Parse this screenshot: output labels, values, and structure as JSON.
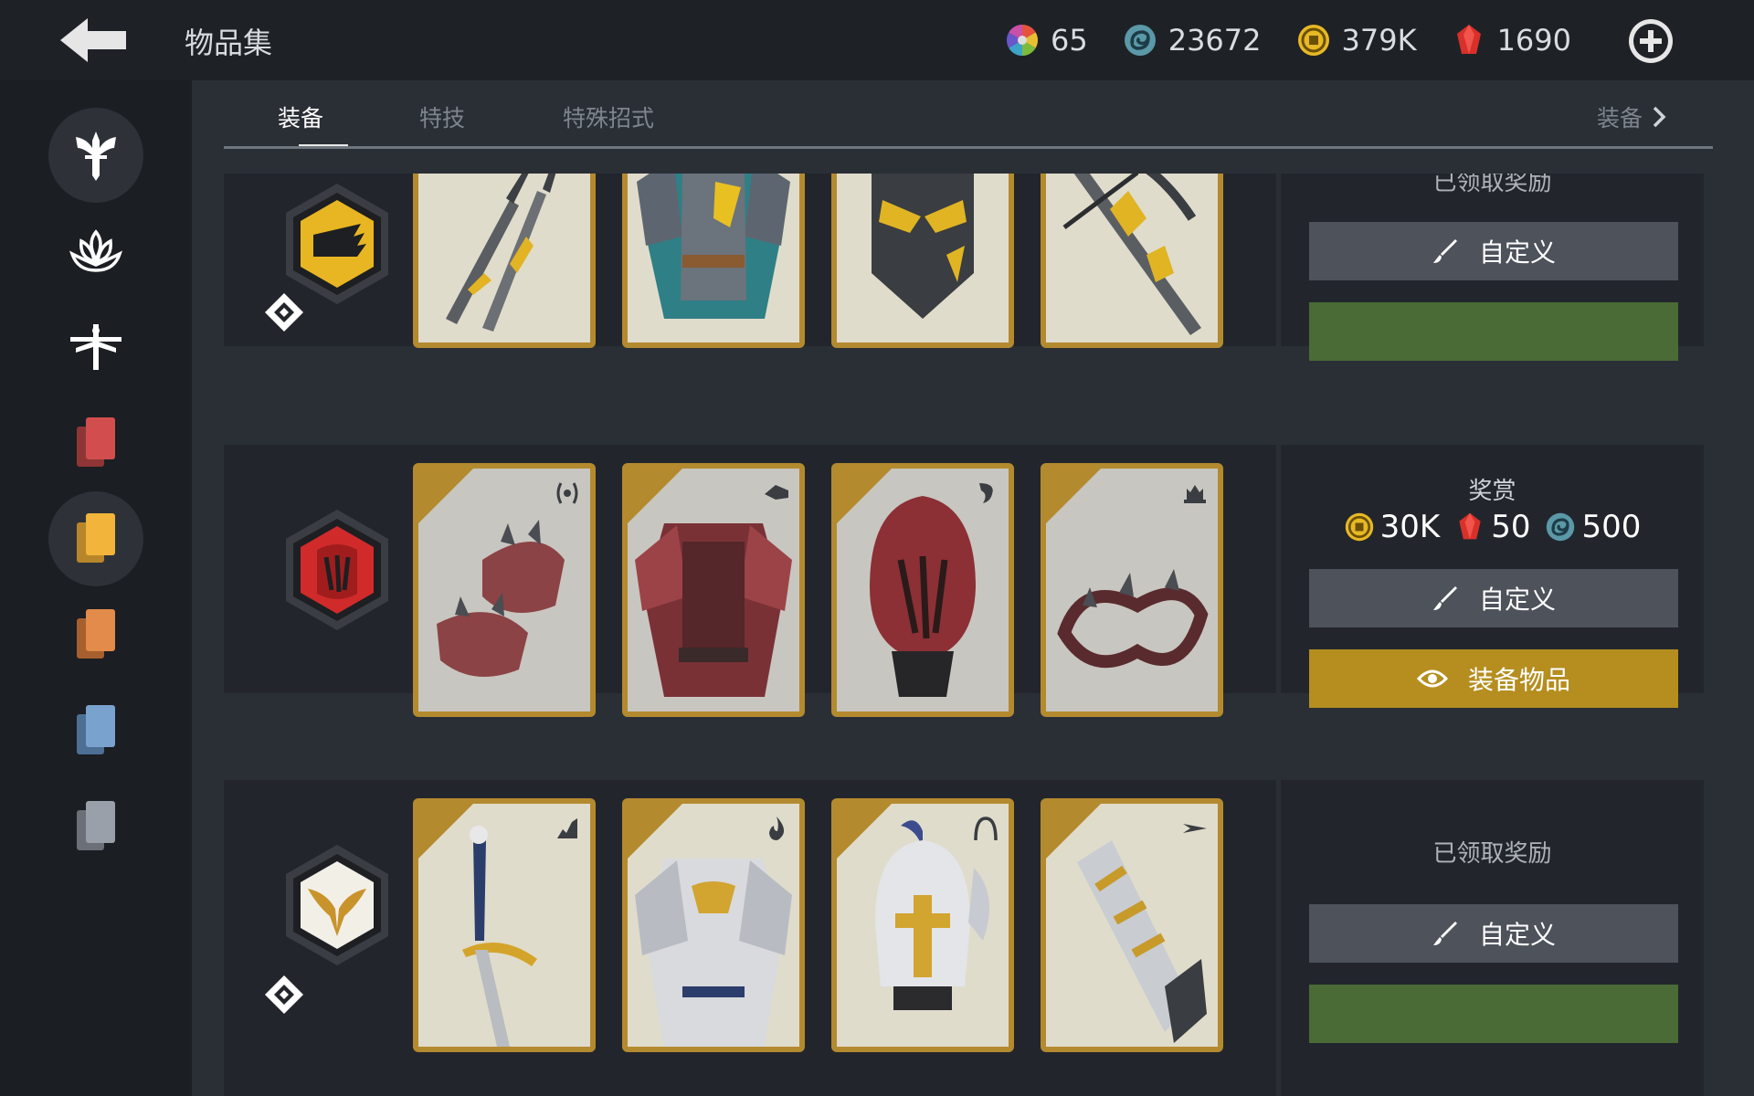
{
  "header": {
    "title": "物品集",
    "currencies": [
      {
        "icon": "color-wheel-icon",
        "value": "65"
      },
      {
        "icon": "steel-swirl-icon",
        "value": "23672"
      },
      {
        "icon": "coin-icon",
        "value": "379K"
      },
      {
        "icon": "red-gem-icon",
        "value": "1690"
      }
    ]
  },
  "tabs": {
    "items": [
      "装备",
      "特技",
      "特殊招式"
    ],
    "active": "装备",
    "right_label": "装备"
  },
  "rows": [
    {
      "reward_status": "已领取奖励",
      "customize_label": "自定义",
      "cards": [
        {
          "name": "dual-swords"
        },
        {
          "name": "chest-armor"
        },
        {
          "name": "helmet"
        },
        {
          "name": "crossbow"
        }
      ]
    },
    {
      "reward_title": "奖赏",
      "rewards": [
        {
          "icon": "coin-icon",
          "value": "30K"
        },
        {
          "icon": "red-gem-icon",
          "value": "50"
        },
        {
          "icon": "steel-swirl-icon",
          "value": "500"
        }
      ],
      "customize_label": "自定义",
      "equip_label": "装备物品",
      "cards": [
        {
          "name": "spiked-bracers"
        },
        {
          "name": "red-chest-armor"
        },
        {
          "name": "red-helmet"
        },
        {
          "name": "spiked-chain"
        }
      ]
    },
    {
      "reward_status": "已领取奖励",
      "customize_label": "自定义",
      "cards": [
        {
          "name": "longsword"
        },
        {
          "name": "white-chest-armor"
        },
        {
          "name": "white-helmet"
        },
        {
          "name": "hand-cannon"
        }
      ]
    }
  ],
  "colors": {
    "accent_gold": "#b58e1f",
    "claimed_green": "#4a6b35",
    "customize_grey": "#4d525b"
  }
}
